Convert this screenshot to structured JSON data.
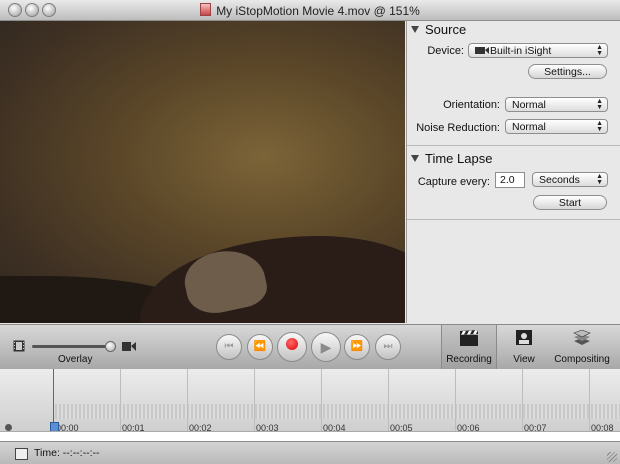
{
  "window": {
    "title": "My iStopMotion Movie 4.mov @ 151%"
  },
  "source": {
    "header": "Source",
    "device_label": "Device:",
    "device_value": "Built-in iSight",
    "settings_button": "Settings...",
    "orientation_label": "Orientation:",
    "orientation_value": "Normal",
    "noise_label": "Noise Reduction:",
    "noise_value": "Normal"
  },
  "timelapse": {
    "header": "Time Lapse",
    "capture_label": "Capture every:",
    "capture_value": "2.0",
    "unit_value": "Seconds",
    "start_button": "Start"
  },
  "toolbar": {
    "overlay_label": "Overlay",
    "modes": [
      {
        "label": "Recording",
        "icon": "clapperboard-icon",
        "active": true
      },
      {
        "label": "View",
        "icon": "view-icon",
        "active": false
      },
      {
        "label": "Compositing",
        "icon": "layers-icon",
        "active": false
      }
    ]
  },
  "timeline": {
    "labels": [
      "00:00",
      "00:01",
      "00:02",
      "00:03",
      "00:04",
      "00:05",
      "00:06",
      "00:07",
      "00:08"
    ]
  },
  "status": {
    "time_text": "Time: --:--:--:--"
  }
}
